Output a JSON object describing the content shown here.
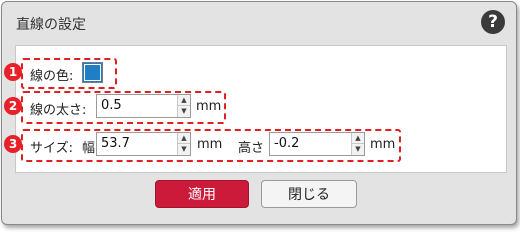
{
  "dialog": {
    "title": "直線の設定",
    "help_icon": "question-circle-icon",
    "help_symbol": "?"
  },
  "markers": [
    "1",
    "2",
    "3"
  ],
  "line_color": {
    "label": "線の色:",
    "color": "#1e7fc4"
  },
  "line_width": {
    "label": "線の太さ:",
    "value": "0.5",
    "unit": "mm"
  },
  "size": {
    "label": "サイズ:",
    "width_label": "幅",
    "width_value": "53.7",
    "width_unit": "mm",
    "height_label": "高さ",
    "height_value": "-0.2",
    "height_unit": "mm"
  },
  "buttons": {
    "apply": "適用",
    "close": "閉じる"
  },
  "colors": {
    "annotation": "#e02020",
    "apply_button": "#cc1a3a"
  }
}
